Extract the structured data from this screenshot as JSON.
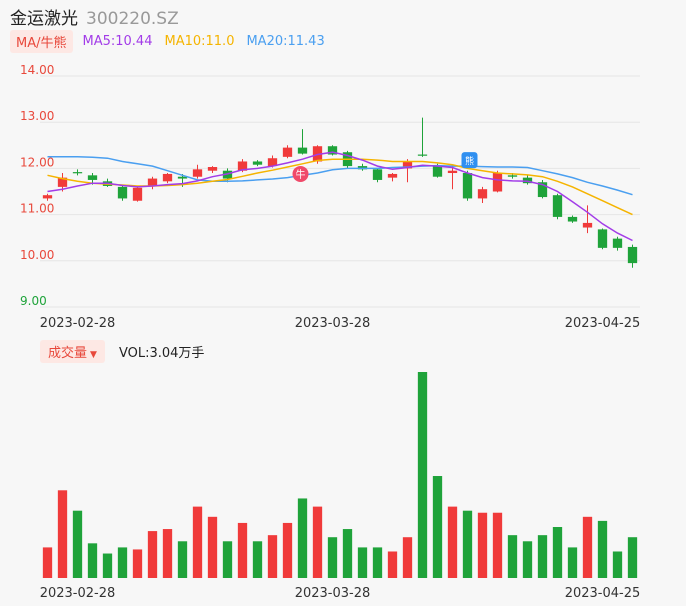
{
  "header": {
    "name": "金运激光",
    "code": "300220.SZ"
  },
  "ma": {
    "badge": "MA/牛熊",
    "ma5": "MA5:10.44",
    "ma10": "MA10:11.0",
    "ma20": "MA20:11.43",
    "ma5_color": "#a23ce8",
    "ma10_color": "#f5b400",
    "ma20_color": "#4a9ff0"
  },
  "volume": {
    "badge": "成交量",
    "text": "VOL:3.04万手"
  },
  "markers": {
    "bull": "牛",
    "blue": "熊"
  },
  "colors": {
    "up": "#f03a3a",
    "down": "#1fa33a",
    "price_axis": "#e8483b",
    "low_axis": "#1fa33a"
  },
  "chart_data": [
    {
      "type": "candlestick",
      "y_ticks": [
        "14.00",
        "13.00",
        "12.00",
        "11.00",
        "10.00",
        "9.00"
      ],
      "ylim": [
        9.0,
        14.0
      ],
      "x_ticks": [
        "2023-02-28",
        "2023-03-28",
        "2023-04-25"
      ],
      "candles": [
        {
          "o": 11.35,
          "h": 11.45,
          "l": 11.3,
          "c": 11.42
        },
        {
          "o": 11.6,
          "h": 11.9,
          "l": 11.5,
          "c": 11.8
        },
        {
          "o": 11.92,
          "h": 11.98,
          "l": 11.85,
          "c": 11.9
        },
        {
          "o": 11.85,
          "h": 11.9,
          "l": 11.65,
          "c": 11.75
        },
        {
          "o": 11.72,
          "h": 11.78,
          "l": 11.6,
          "c": 11.62
        },
        {
          "o": 11.6,
          "h": 11.62,
          "l": 11.3,
          "c": 11.35
        },
        {
          "o": 11.3,
          "h": 11.62,
          "l": 11.28,
          "c": 11.58
        },
        {
          "o": 11.62,
          "h": 11.82,
          "l": 11.55,
          "c": 11.78
        },
        {
          "o": 11.72,
          "h": 11.9,
          "l": 11.68,
          "c": 11.88
        },
        {
          "o": 11.82,
          "h": 11.88,
          "l": 11.6,
          "c": 11.78
        },
        {
          "o": 11.82,
          "h": 12.08,
          "l": 11.78,
          "c": 11.98
        },
        {
          "o": 11.95,
          "h": 12.05,
          "l": 11.9,
          "c": 12.03
        },
        {
          "o": 11.95,
          "h": 12.0,
          "l": 11.7,
          "c": 11.78
        },
        {
          "o": 11.95,
          "h": 12.2,
          "l": 11.92,
          "c": 12.15
        },
        {
          "o": 12.15,
          "h": 12.18,
          "l": 12.05,
          "c": 12.08
        },
        {
          "o": 12.05,
          "h": 12.28,
          "l": 12.02,
          "c": 12.22
        },
        {
          "o": 12.25,
          "h": 12.5,
          "l": 12.22,
          "c": 12.45
        },
        {
          "o": 12.45,
          "h": 12.85,
          "l": 12.3,
          "c": 12.32
        },
        {
          "o": 12.15,
          "h": 12.5,
          "l": 12.1,
          "c": 12.48
        },
        {
          "o": 12.48,
          "h": 12.5,
          "l": 12.28,
          "c": 12.3
        },
        {
          "o": 12.35,
          "h": 12.38,
          "l": 12.0,
          "c": 12.05
        },
        {
          "o": 12.05,
          "h": 12.1,
          "l": 11.95,
          "c": 11.98
        },
        {
          "o": 11.98,
          "h": 12.0,
          "l": 11.7,
          "c": 11.75
        },
        {
          "o": 11.8,
          "h": 11.9,
          "l": 11.72,
          "c": 11.88
        },
        {
          "o": 12.0,
          "h": 12.2,
          "l": 11.7,
          "c": 12.15
        },
        {
          "o": 12.3,
          "h": 13.1,
          "l": 12.25,
          "c": 12.28
        },
        {
          "o": 12.05,
          "h": 12.1,
          "l": 11.8,
          "c": 11.82
        },
        {
          "o": 11.9,
          "h": 12.05,
          "l": 11.55,
          "c": 11.95
        },
        {
          "o": 11.9,
          "h": 11.95,
          "l": 11.3,
          "c": 11.35
        },
        {
          "o": 11.35,
          "h": 11.6,
          "l": 11.25,
          "c": 11.55
        },
        {
          "o": 11.5,
          "h": 11.95,
          "l": 11.48,
          "c": 11.9
        },
        {
          "o": 11.85,
          "h": 11.9,
          "l": 11.78,
          "c": 11.82
        },
        {
          "o": 11.8,
          "h": 11.85,
          "l": 11.65,
          "c": 11.68
        },
        {
          "o": 11.7,
          "h": 11.75,
          "l": 11.35,
          "c": 11.38
        },
        {
          "o": 11.42,
          "h": 11.45,
          "l": 10.9,
          "c": 10.95
        },
        {
          "o": 10.95,
          "h": 10.98,
          "l": 10.82,
          "c": 10.85
        },
        {
          "o": 10.72,
          "h": 11.2,
          "l": 10.6,
          "c": 10.82
        },
        {
          "o": 10.68,
          "h": 10.7,
          "l": 10.25,
          "c": 10.28
        },
        {
          "o": 10.48,
          "h": 10.52,
          "l": 10.22,
          "c": 10.28
        },
        {
          "o": 10.3,
          "h": 10.35,
          "l": 9.85,
          "c": 9.95
        }
      ],
      "ma5": [
        11.5,
        11.55,
        11.62,
        11.68,
        11.68,
        11.63,
        11.6,
        11.62,
        11.65,
        11.67,
        11.73,
        11.82,
        11.88,
        11.97,
        12.0,
        12.05,
        12.12,
        12.2,
        12.3,
        12.35,
        12.28,
        12.18,
        12.05,
        11.98,
        12.02,
        12.07,
        12.05,
        12.02,
        11.9,
        11.8,
        11.75,
        11.73,
        11.72,
        11.65,
        11.5,
        11.28,
        11.05,
        10.8,
        10.6,
        10.44
      ],
      "ma10": [
        11.85,
        11.78,
        11.72,
        11.68,
        11.66,
        11.64,
        11.62,
        11.62,
        11.63,
        11.65,
        11.68,
        11.72,
        11.76,
        11.83,
        11.9,
        11.96,
        12.03,
        12.1,
        12.17,
        12.2,
        12.2,
        12.2,
        12.18,
        12.15,
        12.15,
        12.15,
        12.12,
        12.08,
        12.0,
        11.95,
        11.9,
        11.88,
        11.86,
        11.82,
        11.72,
        11.6,
        11.45,
        11.3,
        11.15,
        11.0
      ],
      "ma20": [
        12.25,
        12.25,
        12.25,
        12.24,
        12.22,
        12.15,
        12.1,
        12.05,
        11.95,
        11.85,
        11.75,
        11.72,
        11.72,
        11.73,
        11.75,
        11.77,
        11.8,
        11.85,
        11.9,
        11.97,
        12.0,
        12.0,
        12.0,
        12.02,
        12.03,
        12.05,
        12.06,
        12.05,
        12.05,
        12.04,
        12.03,
        12.03,
        12.02,
        11.95,
        11.88,
        11.8,
        11.7,
        11.62,
        11.53,
        11.43
      ],
      "volume": [
        1.5,
        4.3,
        3.3,
        1.7,
        1.2,
        1.5,
        1.4,
        2.3,
        2.4,
        1.8,
        3.5,
        3.0,
        1.8,
        2.7,
        1.8,
        2.1,
        2.7,
        3.9,
        3.5,
        2.0,
        2.4,
        1.5,
        1.5,
        1.3,
        2.0,
        10.1,
        5.0,
        3.5,
        3.3,
        3.2,
        3.2,
        2.1,
        1.8,
        2.1,
        2.5,
        1.5,
        3.0,
        2.8,
        1.3,
        2.0
      ]
    }
  ]
}
